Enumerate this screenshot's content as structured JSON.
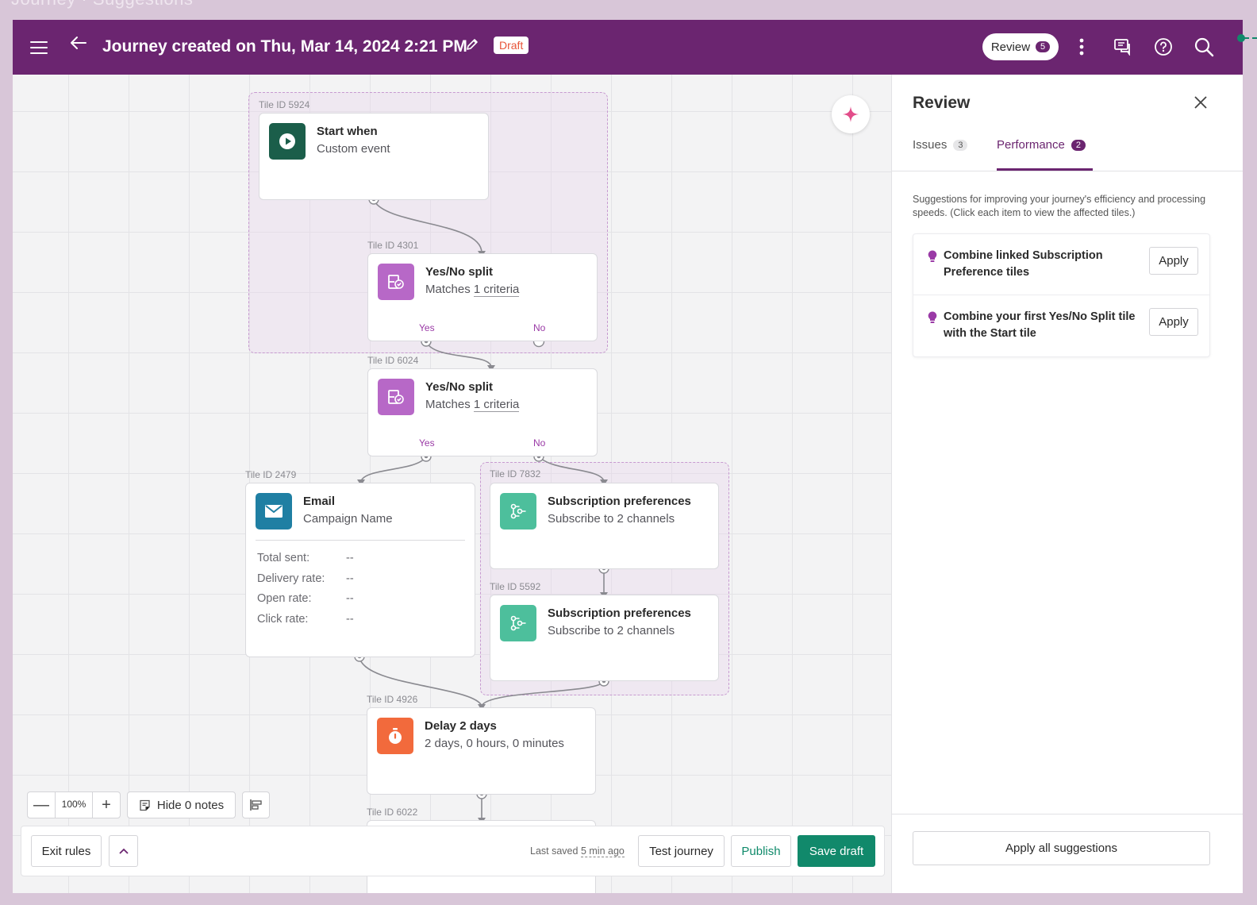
{
  "background_title": "Journey · Suggestions",
  "header": {
    "title": "Journey created on Thu, Mar 14, 2024 2:21 PM",
    "status": "Draft",
    "review_label": "Review",
    "review_count": "5"
  },
  "canvas": {
    "tiles": {
      "start": {
        "id_label": "Tile ID 5924",
        "title": "Start when",
        "subtitle": "Custom event",
        "icon": "play-icon",
        "color": "#1b5e4a"
      },
      "split1": {
        "id_label": "Tile ID 4301",
        "title": "Yes/No split",
        "sub_prefix": "Matches ",
        "sub_link": "1 criteria",
        "yes": "Yes",
        "no": "No",
        "icon": "split-icon",
        "color": "#b768c7"
      },
      "split2": {
        "id_label": "Tile ID 6024",
        "title": "Yes/No split",
        "sub_prefix": "Matches ",
        "sub_link": "1 criteria",
        "yes": "Yes",
        "no": "No",
        "icon": "split-icon",
        "color": "#b768c7"
      },
      "email": {
        "id_label": "Tile ID 2479",
        "title": "Email",
        "subtitle": "Campaign Name",
        "icon": "envelope-icon",
        "color": "#1f7fa3",
        "stats": [
          {
            "label": "Total sent:",
            "value": "--"
          },
          {
            "label": "Delivery rate:",
            "value": "--"
          },
          {
            "label": "Open rate:",
            "value": "--"
          },
          {
            "label": "Click rate:",
            "value": "--"
          }
        ]
      },
      "subs1": {
        "id_label": "Tile ID 7832",
        "title": "Subscription preferences",
        "subtitle": "Subscribe to 2 channels",
        "icon": "subscription-icon",
        "color": "#4dbf9c"
      },
      "subs2": {
        "id_label": "Tile ID 5592",
        "title": "Subscription preferences",
        "subtitle": "Subscribe to 2 channels",
        "icon": "subscription-icon",
        "color": "#4dbf9c"
      },
      "delay": {
        "id_label": "Tile ID 4926",
        "title": "Delay 2 days",
        "subtitle": "2 days, 0 hours, 0 minutes",
        "icon": "stopwatch-icon",
        "color": "#f26a3c"
      },
      "next": {
        "id_label": "Tile ID 6022"
      }
    },
    "zoom": {
      "minus": "—",
      "value": "100%",
      "plus": "+"
    },
    "notes_label": "Hide 0 notes"
  },
  "footer": {
    "exit_rules": "Exit rules",
    "last_saved_prefix": "Last saved",
    "last_saved_ago": "5 min ago",
    "test_journey": "Test journey",
    "publish": "Publish",
    "save_draft": "Save draft"
  },
  "review_panel": {
    "title": "Review",
    "tabs": [
      {
        "label": "Issues",
        "count": "3"
      },
      {
        "label": "Performance",
        "count": "2"
      }
    ],
    "description": "Suggestions for improving your journey's efficiency and processing speeds. (Click each item to view the affected tiles.)",
    "suggestions": [
      {
        "text": "Combine linked Subscription Preference tiles",
        "action": "Apply"
      },
      {
        "text": "Combine your first Yes/No Split tile with the Start tile",
        "action": "Apply"
      }
    ],
    "apply_all": "Apply all suggestions"
  },
  "colors": {
    "header_bg": "#6b2570",
    "accent_green": "#11896b",
    "draft_text": "#e8553a",
    "sparkle": "#e24d8a"
  }
}
